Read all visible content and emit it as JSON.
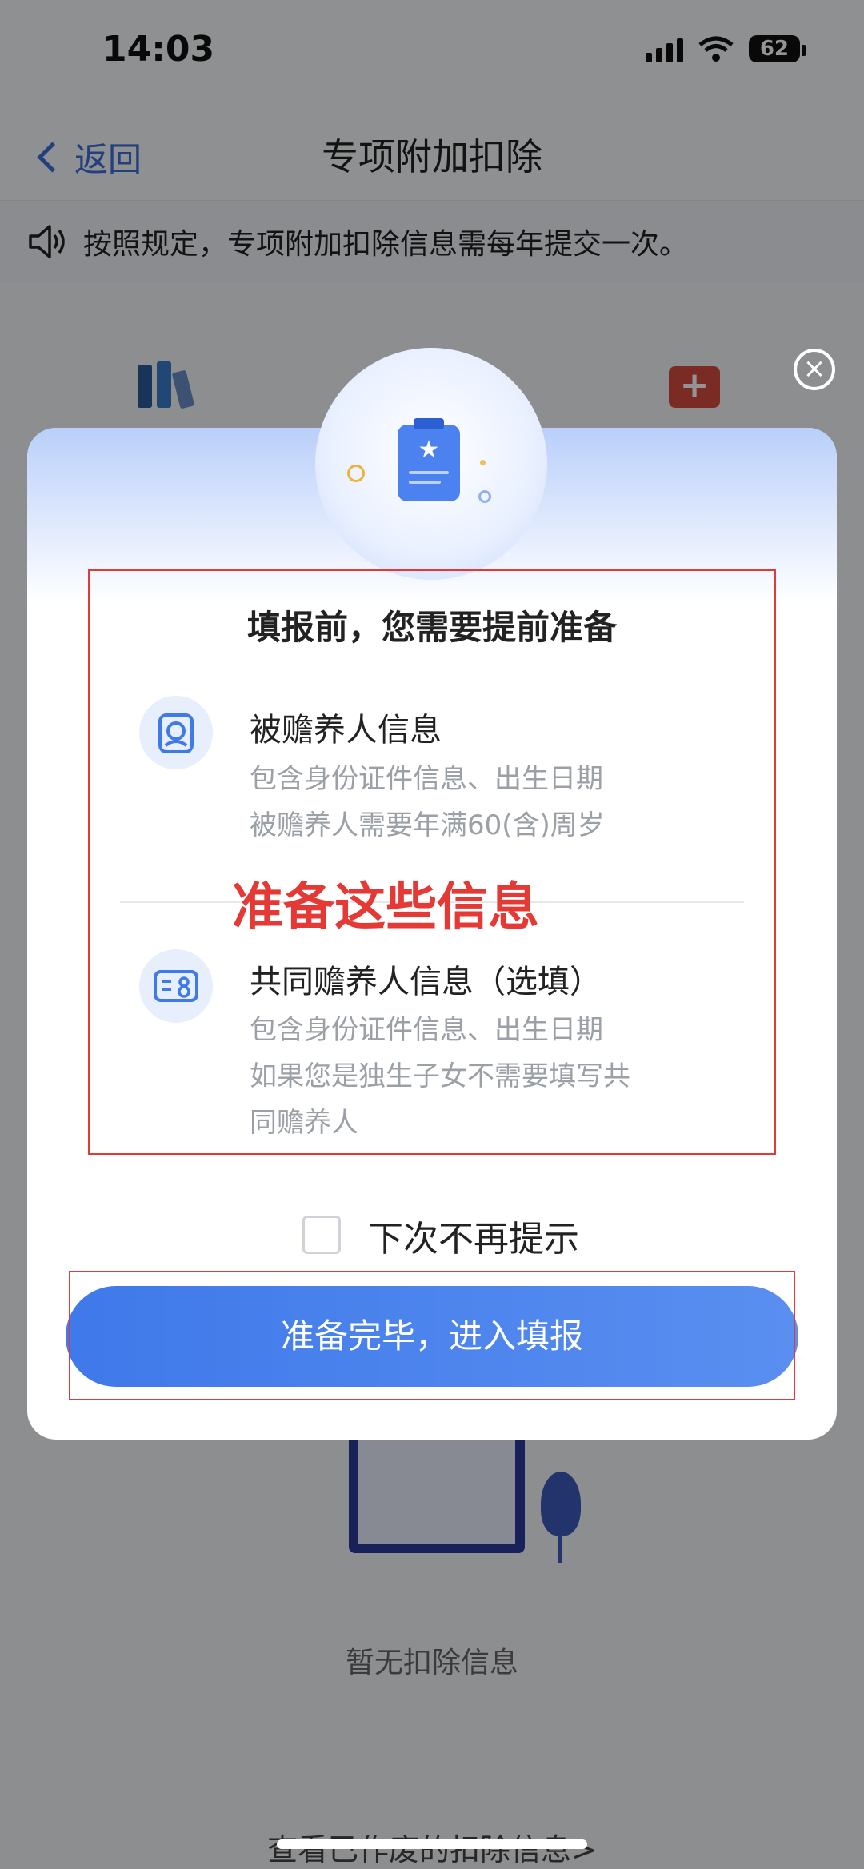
{
  "status_bar": {
    "time": "14:03",
    "battery": "62"
  },
  "nav": {
    "back_label": "返回",
    "title": "专项附加扣除"
  },
  "notice": {
    "text": "按照规定，专项附加扣除信息需每年提交一次。"
  },
  "background": {
    "empty_text": "暂无扣除信息",
    "voided_link": "查看已作废的扣除信息>"
  },
  "modal": {
    "title": "填报前，您需要提前准备",
    "items": [
      {
        "title": "被赡养人信息",
        "desc_line1": "包含身份证件信息、出生日期",
        "desc_line2": "被赡养人需要年满60(含)周岁"
      },
      {
        "title": "共同赡养人信息（选填）",
        "desc_line1": "包含身份证件信息、出生日期",
        "desc_line2": "如果您是独生子女不需要填写共",
        "desc_line3": "同赡养人"
      }
    ],
    "annotation": "准备这些信息",
    "checkbox_label": "下次不再提示",
    "checkbox_checked": false,
    "primary_button": "准备完毕，进入填报"
  },
  "colors": {
    "accent": "#3f79ea",
    "annotation_red": "#e53935"
  }
}
